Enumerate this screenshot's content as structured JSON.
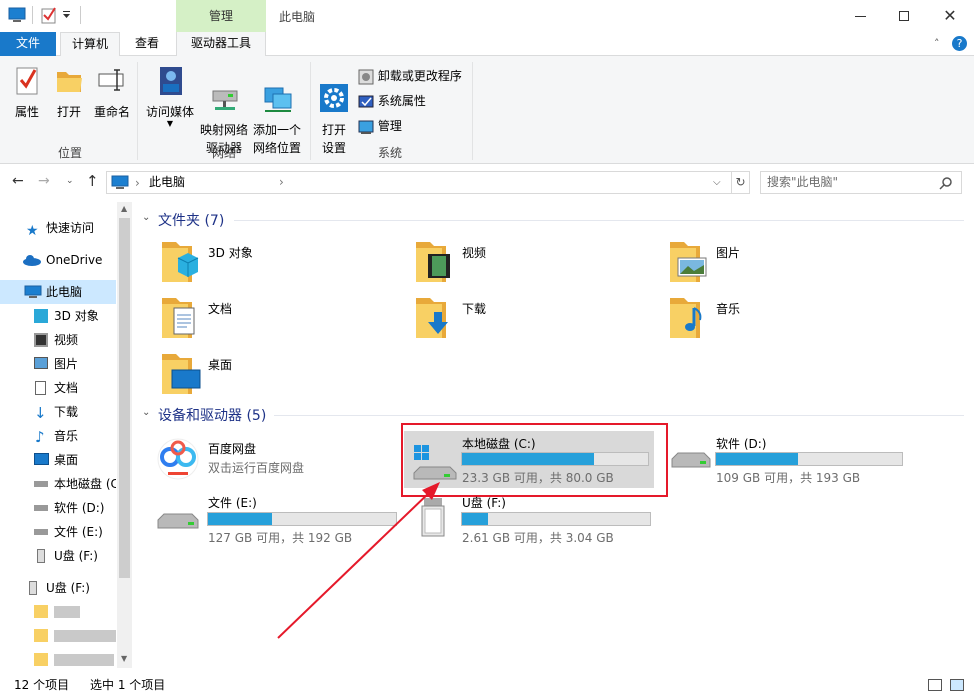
{
  "window": {
    "title": "此电脑",
    "manage_tab": "管理"
  },
  "tabs": [
    "文件",
    "计算机",
    "查看",
    "驱动器工具"
  ],
  "ribbon": {
    "location": {
      "label": "位置",
      "buttons": [
        "属性",
        "打开",
        "重命名"
      ]
    },
    "network": {
      "label": "网络",
      "buttons": [
        "访问媒体",
        "映射网络\n驱动器",
        "添加一个\n网络位置"
      ]
    },
    "system": {
      "label": "系统",
      "open_settings": "打开\n设置",
      "uninstall": "卸载或更改程序",
      "system_props": "系统属性",
      "manage": "管理"
    }
  },
  "address": {
    "path": "此电脑",
    "search_placeholder": "搜索\"此电脑\""
  },
  "nav": {
    "items": [
      "快速访问",
      "OneDrive",
      "此电脑",
      "3D 对象",
      "视频",
      "图片",
      "文档",
      "下载",
      "音乐",
      "桌面",
      "本地磁盘 (C",
      "软件 (D:)",
      "文件 (E:)",
      "U盘 (F:)",
      "U盘 (F:)"
    ]
  },
  "folders": {
    "title": "文件夹 (7)",
    "items": [
      "3D 对象",
      "视频",
      "图片",
      "文档",
      "下载",
      "音乐",
      "桌面"
    ]
  },
  "drives": {
    "title": "设备和驱动器 (5)",
    "baidu": {
      "name": "百度网盘",
      "desc": "双击运行百度网盘"
    },
    "items": [
      {
        "name": "本地磁盘 (C:)",
        "info": "23.3 GB 可用，共 80.0 GB",
        "used_fraction": 0.71
      },
      {
        "name": "软件 (D:)",
        "info": "109 GB 可用，共 193 GB",
        "used_fraction": 0.44
      },
      {
        "name": "文件 (E:)",
        "info": "127 GB 可用，共 192 GB",
        "used_fraction": 0.34
      },
      {
        "name": "U盘 (F:)",
        "info": "2.61 GB 可用，共 3.04 GB",
        "used_fraction": 0.14
      }
    ]
  },
  "status": {
    "count": "12 个项目",
    "selected": "选中 1 个项目"
  },
  "colors": {
    "accent": "#1979ca",
    "progress": "#26a0da",
    "highlight": "#e5192a",
    "manage_tab": "#d5f0c6"
  }
}
